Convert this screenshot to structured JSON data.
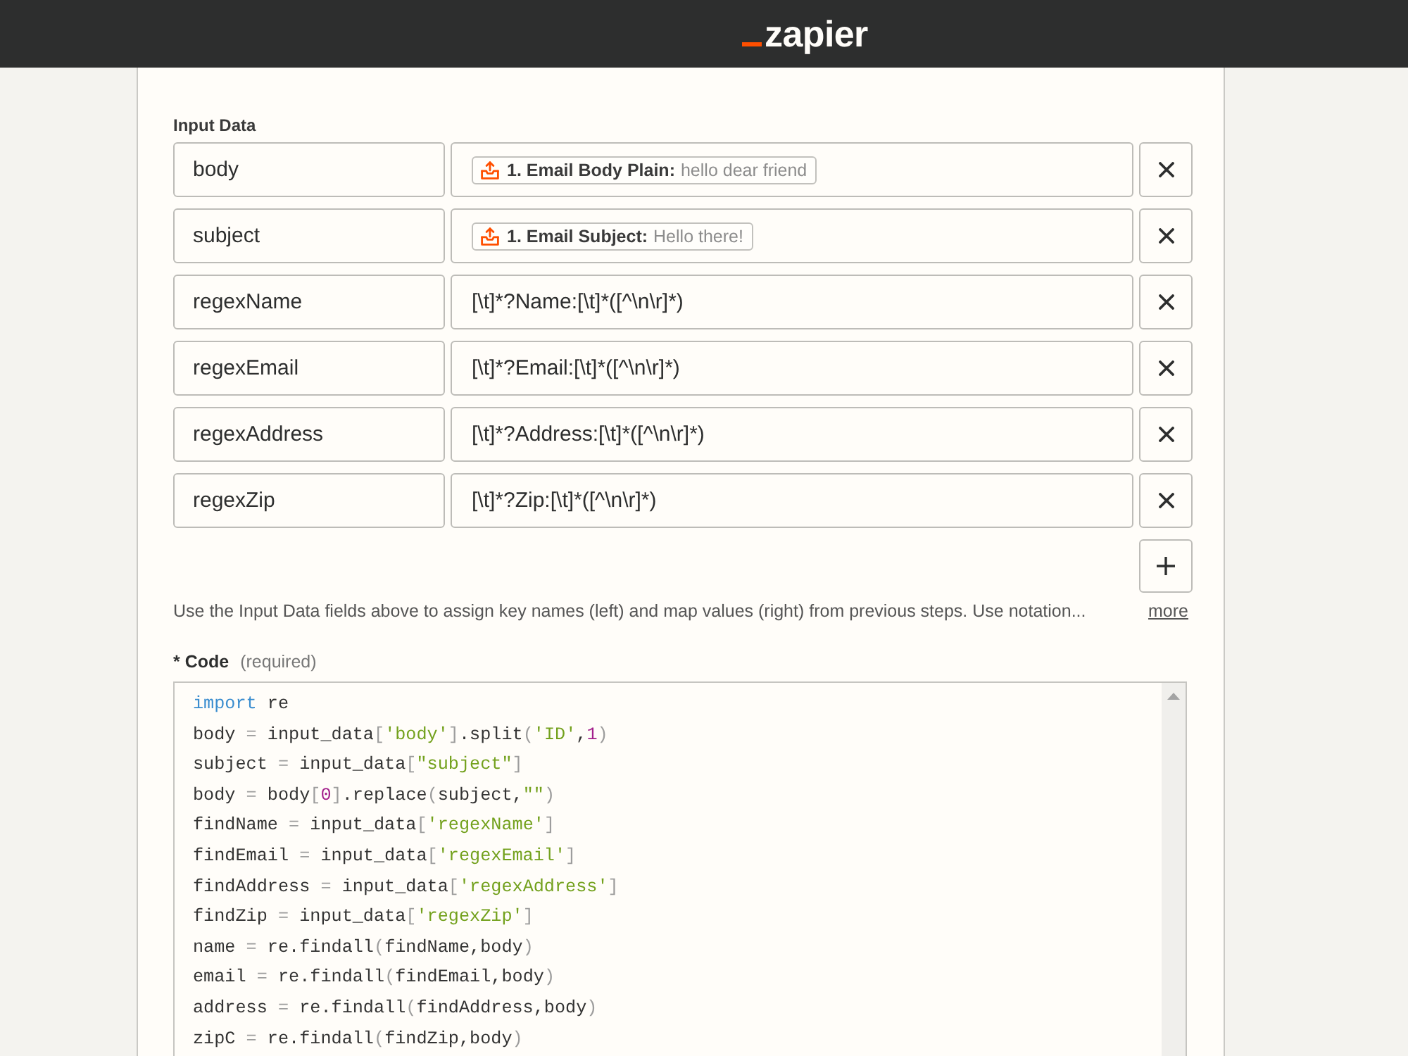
{
  "header": {
    "logo": "zapier"
  },
  "input_data": {
    "label": "Input Data",
    "rows": [
      {
        "key": "body",
        "value": {
          "kind": "mapped",
          "step": "1. Email Body Plain:",
          "sample": "hello dear friend"
        }
      },
      {
        "key": "subject",
        "value": {
          "kind": "mapped",
          "step": "1. Email Subject:",
          "sample": "Hello there!"
        }
      },
      {
        "key": "regexName",
        "value": {
          "kind": "text",
          "text": "[\\t]*?Name:[\\t]*([^\\n\\r]*)"
        }
      },
      {
        "key": "regexEmail",
        "value": {
          "kind": "text",
          "text": "[\\t]*?Email:[\\t]*([^\\n\\r]*)"
        }
      },
      {
        "key": "regexAddress",
        "value": {
          "kind": "text",
          "text": "[\\t]*?Address:[\\t]*([^\\n\\r]*)"
        }
      },
      {
        "key": "regexZip",
        "value": {
          "kind": "text",
          "text": "[\\t]*?Zip:[\\t]*([^\\n\\r]*)"
        }
      }
    ],
    "help": "Use the Input Data fields above to assign key names (left) and map values (right) from previous steps. Use notation...",
    "more_link": "more"
  },
  "code": {
    "label": "* Code",
    "required": "(required)",
    "lines": [
      [
        {
          "kind": "keyword",
          "text": "import"
        },
        {
          "kind": "plain",
          "text": " re"
        }
      ],
      [
        {
          "kind": "plain",
          "text": "body "
        },
        {
          "kind": "punct",
          "text": "="
        },
        {
          "kind": "plain",
          "text": " input_data"
        },
        {
          "kind": "punct",
          "text": "["
        },
        {
          "kind": "string",
          "text": "'body'"
        },
        {
          "kind": "punct",
          "text": "]"
        },
        {
          "kind": "plain",
          "text": ".split"
        },
        {
          "kind": "punct",
          "text": "("
        },
        {
          "kind": "string",
          "text": "'ID'"
        },
        {
          "kind": "plain",
          "text": ","
        },
        {
          "kind": "number",
          "text": "1"
        },
        {
          "kind": "punct",
          "text": ")"
        }
      ],
      [
        {
          "kind": "plain",
          "text": "subject "
        },
        {
          "kind": "punct",
          "text": "="
        },
        {
          "kind": "plain",
          "text": " input_data"
        },
        {
          "kind": "punct",
          "text": "["
        },
        {
          "kind": "string",
          "text": "\"subject\""
        },
        {
          "kind": "punct",
          "text": "]"
        }
      ],
      [
        {
          "kind": "plain",
          "text": "body "
        },
        {
          "kind": "punct",
          "text": "="
        },
        {
          "kind": "plain",
          "text": " body"
        },
        {
          "kind": "punct",
          "text": "["
        },
        {
          "kind": "number",
          "text": "0"
        },
        {
          "kind": "punct",
          "text": "]"
        },
        {
          "kind": "plain",
          "text": ".replace"
        },
        {
          "kind": "punct",
          "text": "("
        },
        {
          "kind": "plain",
          "text": "subject,"
        },
        {
          "kind": "string",
          "text": "\"\""
        },
        {
          "kind": "punct",
          "text": ")"
        }
      ],
      [
        {
          "kind": "plain",
          "text": "findName "
        },
        {
          "kind": "punct",
          "text": "="
        },
        {
          "kind": "plain",
          "text": " input_data"
        },
        {
          "kind": "punct",
          "text": "["
        },
        {
          "kind": "string",
          "text": "'regexName'"
        },
        {
          "kind": "punct",
          "text": "]"
        }
      ],
      [
        {
          "kind": "plain",
          "text": "findEmail "
        },
        {
          "kind": "punct",
          "text": "="
        },
        {
          "kind": "plain",
          "text": " input_data"
        },
        {
          "kind": "punct",
          "text": "["
        },
        {
          "kind": "string",
          "text": "'regexEmail'"
        },
        {
          "kind": "punct",
          "text": "]"
        }
      ],
      [
        {
          "kind": "plain",
          "text": "findAddress "
        },
        {
          "kind": "punct",
          "text": "="
        },
        {
          "kind": "plain",
          "text": " input_data"
        },
        {
          "kind": "punct",
          "text": "["
        },
        {
          "kind": "string",
          "text": "'regexAddress'"
        },
        {
          "kind": "punct",
          "text": "]"
        }
      ],
      [
        {
          "kind": "plain",
          "text": "findZip "
        },
        {
          "kind": "punct",
          "text": "="
        },
        {
          "kind": "plain",
          "text": " input_data"
        },
        {
          "kind": "punct",
          "text": "["
        },
        {
          "kind": "string",
          "text": "'regexZip'"
        },
        {
          "kind": "punct",
          "text": "]"
        }
      ],
      [
        {
          "kind": "plain",
          "text": "name "
        },
        {
          "kind": "punct",
          "text": "="
        },
        {
          "kind": "plain",
          "text": " re.findall"
        },
        {
          "kind": "punct",
          "text": "("
        },
        {
          "kind": "plain",
          "text": "findName,body"
        },
        {
          "kind": "punct",
          "text": ")"
        }
      ],
      [
        {
          "kind": "plain",
          "text": "email "
        },
        {
          "kind": "punct",
          "text": "="
        },
        {
          "kind": "plain",
          "text": " re.findall"
        },
        {
          "kind": "punct",
          "text": "("
        },
        {
          "kind": "plain",
          "text": "findEmail,body"
        },
        {
          "kind": "punct",
          "text": ")"
        }
      ],
      [
        {
          "kind": "plain",
          "text": "address "
        },
        {
          "kind": "punct",
          "text": "="
        },
        {
          "kind": "plain",
          "text": " re.findall"
        },
        {
          "kind": "punct",
          "text": "("
        },
        {
          "kind": "plain",
          "text": "findAddress,body"
        },
        {
          "kind": "punct",
          "text": ")"
        }
      ],
      [
        {
          "kind": "plain",
          "text": "zipC "
        },
        {
          "kind": "punct",
          "text": "="
        },
        {
          "kind": "plain",
          "text": " re.findall"
        },
        {
          "kind": "punct",
          "text": "("
        },
        {
          "kind": "plain",
          "text": "findZip,body"
        },
        {
          "kind": "punct",
          "text": ")"
        }
      ]
    ]
  }
}
